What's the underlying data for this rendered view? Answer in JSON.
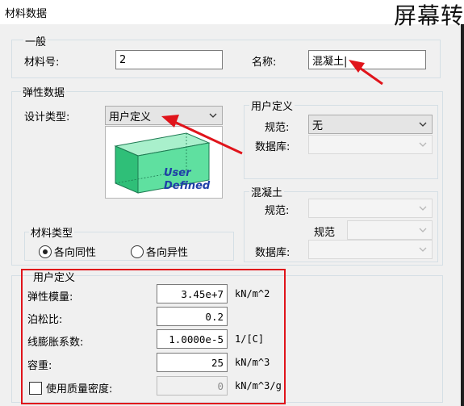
{
  "window": {
    "title": "材料数据",
    "corner_text": "屏幕转"
  },
  "general": {
    "legend": "一般",
    "material_no_label": "材料号:",
    "material_no_value": "2",
    "name_label": "名称:",
    "name_value": "混凝土|"
  },
  "elastic": {
    "legend": "弹性数据",
    "design_type_label": "设计类型:",
    "design_type_value": "用户定义",
    "preview_line1": "User",
    "preview_line2": "Defined"
  },
  "user_defined_spec": {
    "legend": "用户定义",
    "spec_label": "规范:",
    "spec_value": "无",
    "db_label": "数据库:"
  },
  "concrete": {
    "legend": "混凝土",
    "spec_label": "规范:",
    "sub_spec_label": "规范",
    "db_label": "数据库:"
  },
  "material_type": {
    "legend": "材料类型",
    "isotropic": "各向同性",
    "anisotropic": "各向异性",
    "selected": "isotropic"
  },
  "user_props": {
    "legend": "用户定义",
    "rows": [
      {
        "label": "弹性模量:",
        "value": "3.45e+7",
        "unit": "kN/m^2"
      },
      {
        "label": "泊松比:",
        "value": "0.2",
        "unit": ""
      },
      {
        "label": "线膨胀系数:",
        "value": "1.0000e-5",
        "unit": "1/[C]"
      },
      {
        "label": "容重:",
        "value": "25",
        "unit": "kN/m^3"
      }
    ],
    "mass_density_label": "使用质量密度:",
    "mass_density_value": "0",
    "mass_density_unit": "kN/m^3/g"
  },
  "colors": {
    "accent_red": "#e0141b",
    "box_green": "#3fd08a"
  }
}
